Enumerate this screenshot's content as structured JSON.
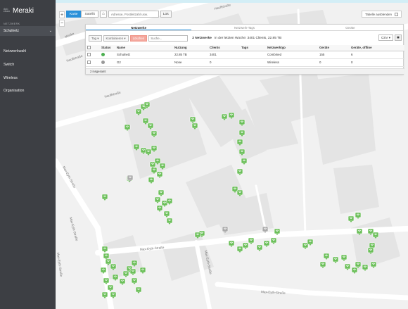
{
  "app": {
    "brand_mark": "cisco",
    "brand_name": "Meraki"
  },
  "sidebar": {
    "network_label": "NETZWERK",
    "network_value": "Schulnetz",
    "items": [
      {
        "label": "Netzwerkwahl"
      },
      {
        "label": "Switch"
      },
      {
        "label": "Wireless"
      },
      {
        "label": "Organisation"
      }
    ]
  },
  "toolbar": {
    "zoom_in": "+",
    "zoom_out": "−",
    "map_view": "Karte",
    "satellite_view": "Satellit",
    "address_placeholder": "Adresse, Postleitzahl usw.",
    "go_label": "Los",
    "show_table_label": "Tabelle ausblenden"
  },
  "panel": {
    "tabs": [
      "Netzwerke",
      "Netzwerk-Tags",
      "Geräte"
    ],
    "filter": {
      "tag_label": "Tag",
      "combine_label": "Kombinieren",
      "delete_label": "Löschen",
      "search_placeholder": "Suche...",
      "summary_prefix": "2 Netzwerke",
      "summary_text": "In der letzten Woche: 3401 Clients, 22.85 TB",
      "csv_label": "CSV ▾"
    },
    "columns": [
      "",
      "Status",
      "Name",
      "Nutzung",
      "Clients",
      "Tags",
      "Netzwerktyp",
      "Geräte",
      "Geräte, offline"
    ],
    "rows": [
      {
        "status": "online",
        "name": "Schulnetz",
        "usage": "22.85 TB",
        "clients": "3401",
        "tags": "",
        "type": "Combined",
        "devices": "155",
        "offline": "6"
      },
      {
        "status": "offline",
        "name": "G2",
        "usage": "None",
        "clients": "0",
        "tags": "",
        "type": "Wireless",
        "devices": "0",
        "offline": "0"
      }
    ],
    "footer": "2 insgesamt"
  },
  "map": {
    "roads": [
      "Hauffstraße",
      "Hauffstraße",
      "Hauffstraße",
      "Max-Eyth-Straße",
      "Max-Eyth-Straße",
      "Max-Eyth-Straße",
      "Max-Eyth-Straße",
      "Max-Eyth-Straße",
      "Max-Eyth-Straße",
      "Mörike"
    ],
    "colors": {
      "ap_online": "#6bbf59",
      "ap_offline": "#aaaaaa",
      "status_online": "#4caf50",
      "status_offline": "#999999",
      "accent": "#2a90d9"
    }
  }
}
